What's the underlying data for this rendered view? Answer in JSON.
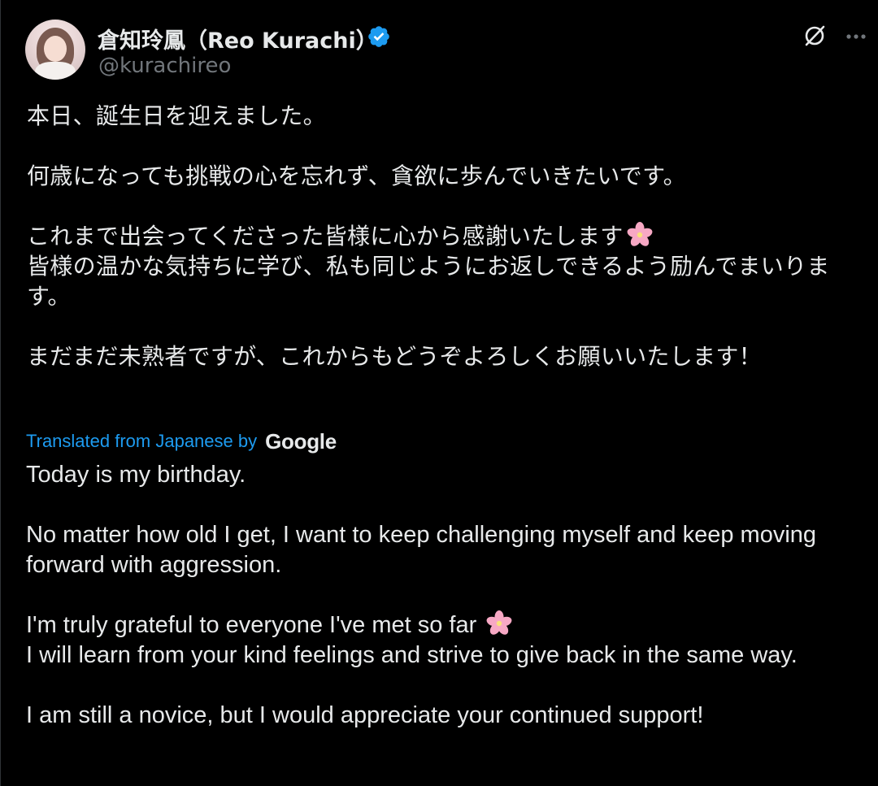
{
  "author": {
    "name": "倉知玲鳳（Reo Kurachi）",
    "handle": "@kurachireo",
    "verified": true
  },
  "icons": {
    "verified": "verified-badge-icon",
    "grok": "grok-icon",
    "more": "more-options-icon",
    "emoji": "cherry-blossom-icon"
  },
  "colors": {
    "background": "#000000",
    "text": "#e7e9ea",
    "secondary": "#71767b",
    "accent": "#1d9bf0"
  },
  "post": {
    "original_paragraphs": [
      "本日、誕生日を迎えました。",
      "何歳になっても挑戦の心を忘れず、貪欲に歩んでいきたいです。",
      "これまで出会ってくださった皆様に心から感謝いたします",
      "皆様の温かな気持ちに学び、私も同じようにお返しできるよう励んでまいります。",
      "まだまだ未熟者ですが、これからもどうぞよろしくお願いいたします！"
    ],
    "translation_label": "Translated from Japanese by",
    "translation_provider": "Google",
    "translated_paragraphs": [
      "Today is my birthday.",
      "No matter how old I get, I want to keep challenging myself and keep moving forward with aggression.",
      "I'm truly grateful to everyone I've met so far",
      "I will learn from your kind feelings and strive to give back in the same way.",
      "I am still a novice, but I would appreciate your continued support!"
    ]
  }
}
